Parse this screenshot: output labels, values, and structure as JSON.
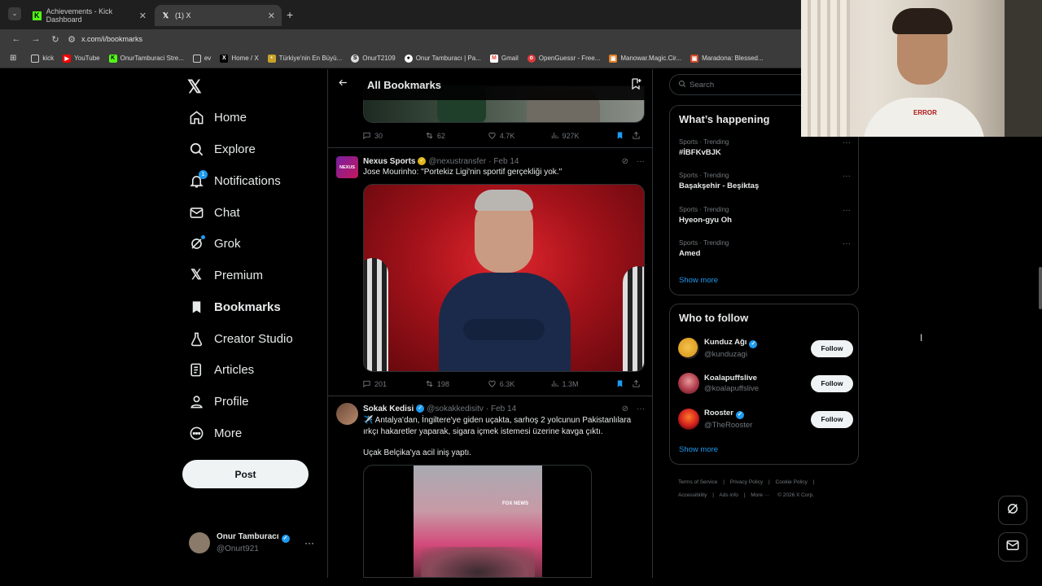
{
  "browser": {
    "tabs": [
      {
        "title": "Achievements - Kick Dashboard",
        "icon": "kick-icon"
      },
      {
        "title": "(1) X",
        "icon": "x-icon"
      }
    ],
    "new_tab": "+",
    "url": "x.com/i/bookmarks",
    "bookmarks": [
      {
        "label": "kick",
        "icon": "folder-icon"
      },
      {
        "label": "YouTube",
        "icon": "youtube-icon"
      },
      {
        "label": "OnurTamburaci Stre...",
        "icon": "kick-icon"
      },
      {
        "label": "ev",
        "icon": "folder-icon"
      },
      {
        "label": "Home / X",
        "icon": "x-icon"
      },
      {
        "label": "Türkiye'nin En Büyü...",
        "icon": "site-icon"
      },
      {
        "label": "OnurT2109",
        "icon": "steam-icon"
      },
      {
        "label": "Onur Tamburacı | Pa...",
        "icon": "site-icon"
      },
      {
        "label": "Gmail",
        "icon": "gmail-icon"
      },
      {
        "label": "OpenGuessr - Free...",
        "icon": "site-icon"
      },
      {
        "label": "Manowar.Magic.Cir...",
        "icon": "site-icon"
      },
      {
        "label": "Maradona: Blessed...",
        "icon": "site-icon"
      }
    ]
  },
  "nav": {
    "items": [
      {
        "label": "Home",
        "icon": "home-icon"
      },
      {
        "label": "Explore",
        "icon": "search-icon"
      },
      {
        "label": "Notifications",
        "icon": "bell-icon",
        "badge": "1"
      },
      {
        "label": "Chat",
        "icon": "mail-icon"
      },
      {
        "label": "Grok",
        "icon": "grok-icon"
      },
      {
        "label": "Premium",
        "icon": "x-logo-icon"
      },
      {
        "label": "Bookmarks",
        "icon": "bookmark-icon"
      },
      {
        "label": "Creator Studio",
        "icon": "flask-icon"
      },
      {
        "label": "Articles",
        "icon": "article-icon"
      },
      {
        "label": "Profile",
        "icon": "person-icon"
      },
      {
        "label": "More",
        "icon": "more-circle-icon"
      }
    ],
    "post_label": "Post",
    "account": {
      "name": "Onur Tamburacı",
      "handle": "@Onurt921"
    }
  },
  "header": {
    "title": "All Bookmarks"
  },
  "tweets": [
    {
      "stats": {
        "replies": "30",
        "reposts": "62",
        "likes": "4.7K",
        "views": "927K"
      }
    },
    {
      "name": "Nexus Sports",
      "handle": "@nexustransfer",
      "date": "· Feb 14",
      "text": "Jose Mourinho: \"Portekiz Ligi'nin sportif gerçekliği yok.\"",
      "avatar_text": "NEXUS",
      "stats": {
        "replies": "201",
        "reposts": "198",
        "likes": "6.3K",
        "views": "1.3M"
      }
    },
    {
      "name": "Sokak Kedisi",
      "handle": "@sokakkedisitv",
      "date": "· Feb 14",
      "text": "✈️ Antalya'dan, İngiltere'ye giden uçakta, sarhoş 2 yolcunun Pakistanlılara ırkçı hakaretler yaparak, sigara içmek istemesi üzerine kavga çıktı.",
      "text2": "Uçak  Belçika'ya acil iniş yaptı.",
      "video_watermark": "FOX NEWS"
    }
  ],
  "search": {
    "placeholder": "Search"
  },
  "trending": {
    "title": "What’s happening",
    "items": [
      {
        "meta": "Sports · Trending",
        "name": "#İBFKvBJK"
      },
      {
        "meta": "Sports · Trending",
        "name": "Başakşehir - Beşiktaş"
      },
      {
        "meta": "Sports · Trending",
        "name": "Hyeon-gyu Oh"
      },
      {
        "meta": "Sports · Trending",
        "name": "Amed"
      }
    ],
    "show_more": "Show more"
  },
  "who_to_follow": {
    "title": "Who to follow",
    "users": [
      {
        "name": "Kunduz Ağı",
        "handle": "@kunduzagi",
        "verified": true
      },
      {
        "name": "Koalapuffslive",
        "handle": "@koalapuffslive",
        "verified": false
      },
      {
        "name": "Rooster",
        "handle": "@TheRooster",
        "verified": true
      }
    ],
    "follow_label": "Follow",
    "show_more": "Show more"
  },
  "footer": {
    "links": [
      "Terms of Service",
      "|",
      "Privacy Policy",
      "|",
      "Cookie Policy",
      "|",
      "Accessibility",
      "|",
      "Ads info",
      "|",
      "More ···",
      "© 2026 X Corp."
    ]
  },
  "webcam": {
    "shirt_text": "ERROR"
  },
  "colors": {
    "accent": "#1d9bf0",
    "gold": "#e2b719",
    "background": "#000000"
  }
}
